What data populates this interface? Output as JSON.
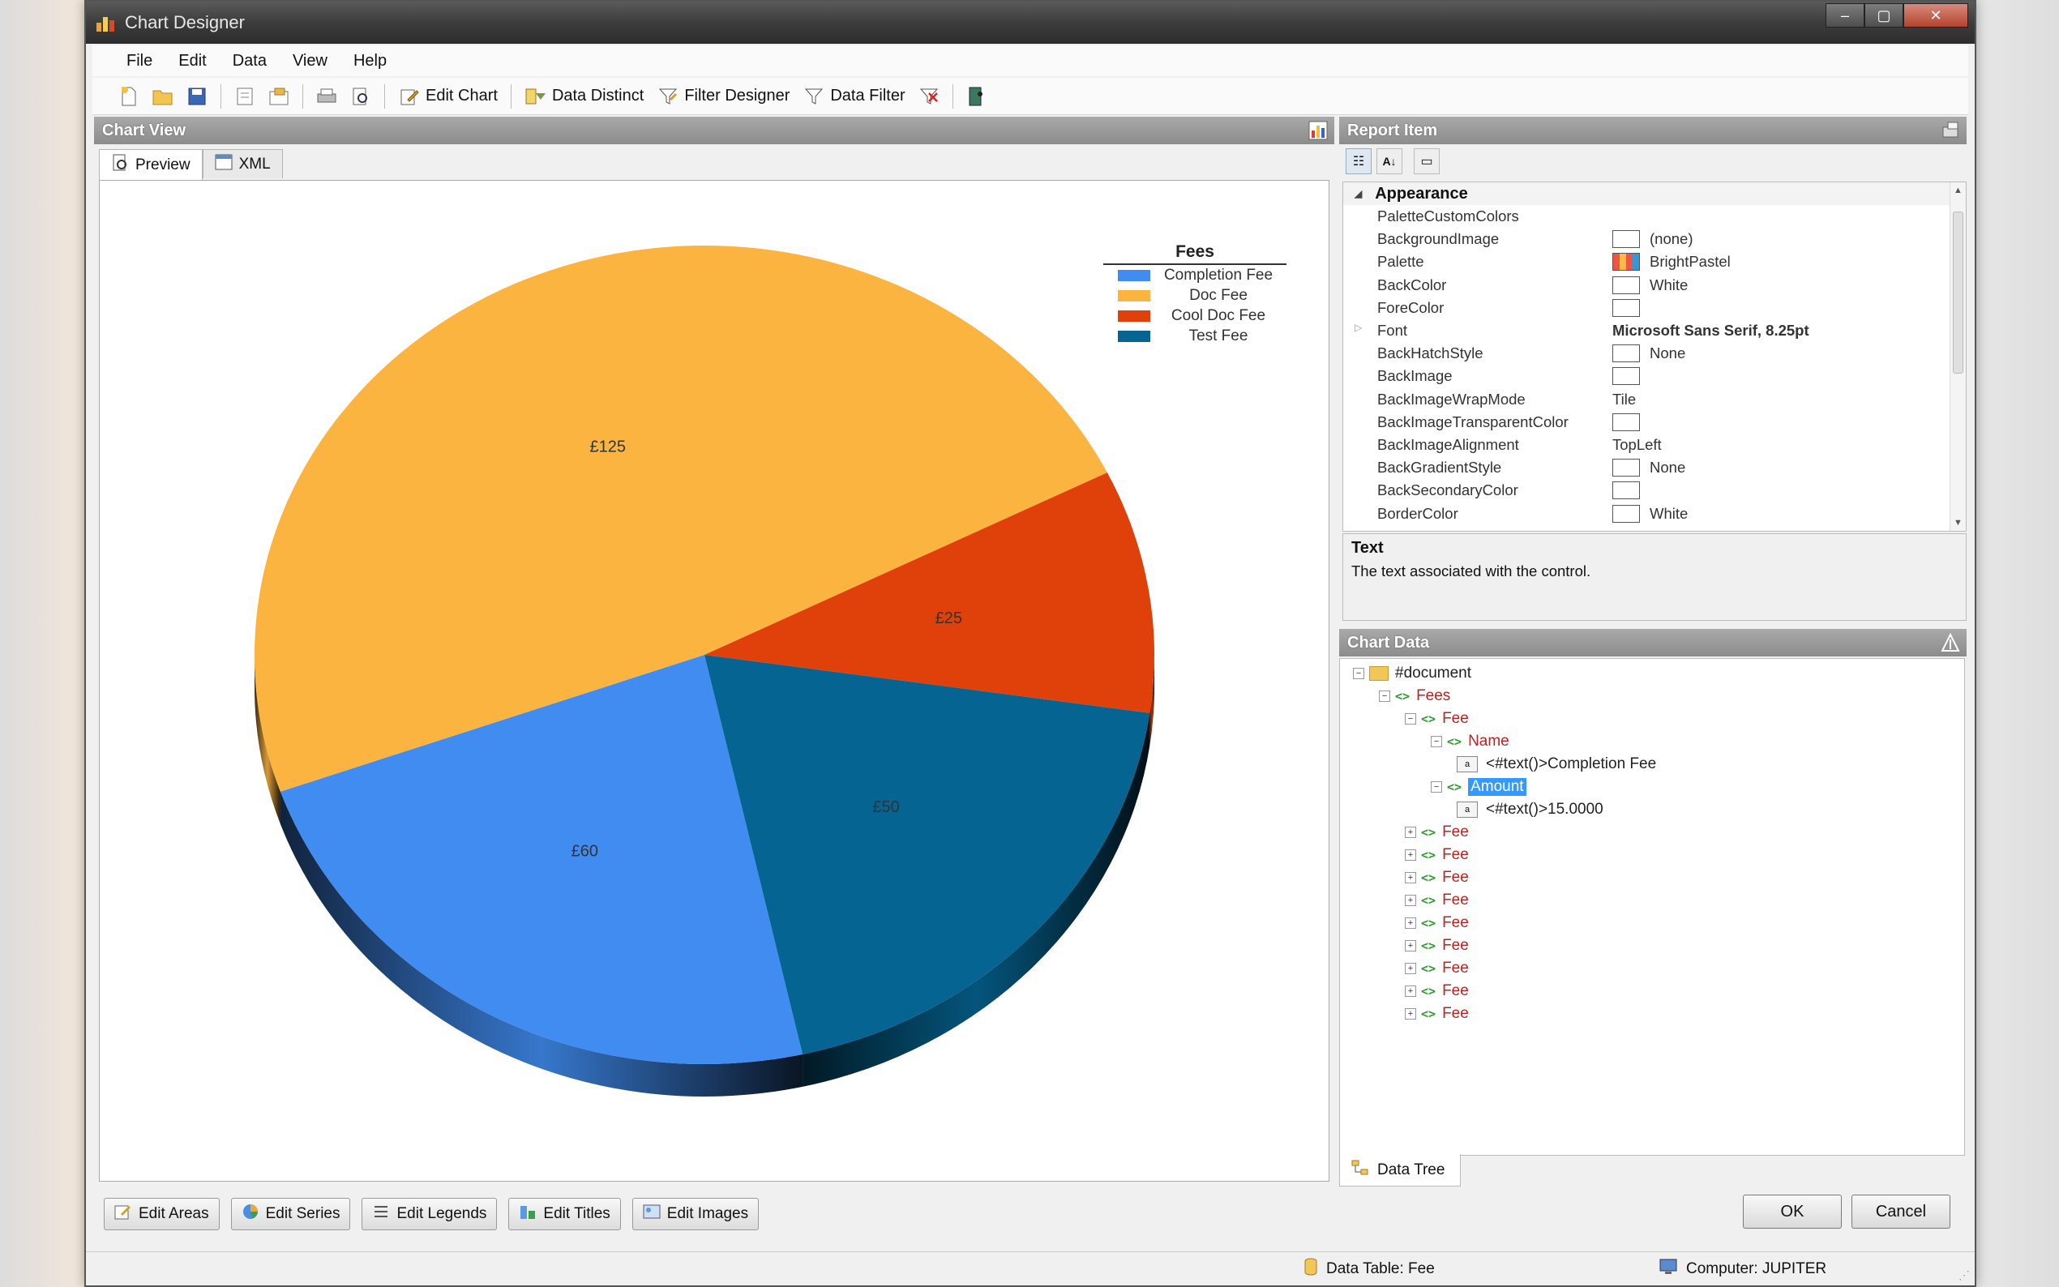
{
  "window": {
    "title": "Chart Designer",
    "buttons": {
      "minimize": "–",
      "maximize": "▢",
      "close": "✕"
    }
  },
  "menu": [
    "File",
    "Edit",
    "Data",
    "View",
    "Help"
  ],
  "toolbar": {
    "edit_chart": "Edit Chart",
    "data_distinct": "Data Distinct",
    "filter_designer": "Filter Designer",
    "data_filter": "Data Filter"
  },
  "chart_view": {
    "header": "Chart View",
    "tabs": [
      "Preview",
      "XML"
    ]
  },
  "chart_data": {
    "type": "pie",
    "title": "",
    "legend_title": "Fees",
    "legend_placement": "top-right",
    "style": "3d",
    "categories": [
      "Completion Fee",
      "Doc Fee",
      "Cool Doc Fee",
      "Test Fee"
    ],
    "values": [
      60,
      125,
      25,
      50
    ],
    "data_labels": [
      "£60",
      "£125",
      "£25",
      "£50"
    ],
    "colors": [
      "#418CF0",
      "#FCB441",
      "#E0400A",
      "#056492"
    ],
    "legend": [
      {
        "name": "Completion Fee",
        "color": "#418CF0"
      },
      {
        "name": "Doc Fee",
        "color": "#FCB441"
      },
      {
        "name": "Cool Doc Fee",
        "color": "#E0400A"
      },
      {
        "name": "Test Fee",
        "color": "#056492"
      }
    ]
  },
  "report_item": {
    "header": "Report Item",
    "category": "Appearance",
    "properties": [
      {
        "name": "PaletteCustomColors",
        "value": "",
        "swatch": "none"
      },
      {
        "name": "BackgroundImage",
        "value": "(none)",
        "swatch": "box"
      },
      {
        "name": "Palette",
        "value": "BrightPastel",
        "swatch": "palette"
      },
      {
        "name": "BackColor",
        "value": "White",
        "swatch": "box"
      },
      {
        "name": "ForeColor",
        "value": "",
        "swatch": "box"
      },
      {
        "name": "Font",
        "value": "Microsoft Sans Serif, 8.25pt",
        "swatch": "none",
        "bold": true,
        "expandable": true
      },
      {
        "name": "BackHatchStyle",
        "value": "None",
        "swatch": "box"
      },
      {
        "name": "BackImage",
        "value": "",
        "swatch": "box"
      },
      {
        "name": "BackImageWrapMode",
        "value": "Tile",
        "swatch": "none"
      },
      {
        "name": "BackImageTransparentColor",
        "value": "",
        "swatch": "box"
      },
      {
        "name": "BackImageAlignment",
        "value": "TopLeft",
        "swatch": "none"
      },
      {
        "name": "BackGradientStyle",
        "value": "None",
        "swatch": "box"
      },
      {
        "name": "BackSecondaryColor",
        "value": "",
        "swatch": "box"
      },
      {
        "name": "BorderColor",
        "value": "White",
        "swatch": "box"
      }
    ],
    "help_title": "Text",
    "help_desc": "The text associated with the control."
  },
  "chart_data_panel": {
    "header": "Chart Data",
    "tree": {
      "root": "#document",
      "fees": "Fees",
      "fee": "Fee",
      "name": "Name",
      "name_text": "<#text()>Completion Fee",
      "amount": "Amount",
      "amount_text": "<#text()>15.0000"
    },
    "tab": "Data Tree"
  },
  "bottom_buttons": [
    "Edit Areas",
    "Edit Series",
    "Edit Legends",
    "Edit Titles",
    "Edit Images"
  ],
  "dialog": {
    "ok": "OK",
    "cancel": "Cancel"
  },
  "status": {
    "data_table": "Data Table: Fee",
    "computer": "Computer: JUPITER"
  }
}
